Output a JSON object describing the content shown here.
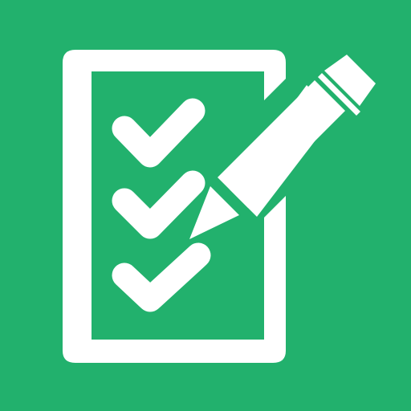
{
  "icon": {
    "name": "checklist-pencil-icon",
    "background_color": "#22b16d",
    "foreground_color": "#ffffff",
    "parts": [
      "clipboard-frame-icon",
      "checkmark-icon",
      "checkmark-icon",
      "checkmark-icon",
      "pencil-icon"
    ]
  }
}
